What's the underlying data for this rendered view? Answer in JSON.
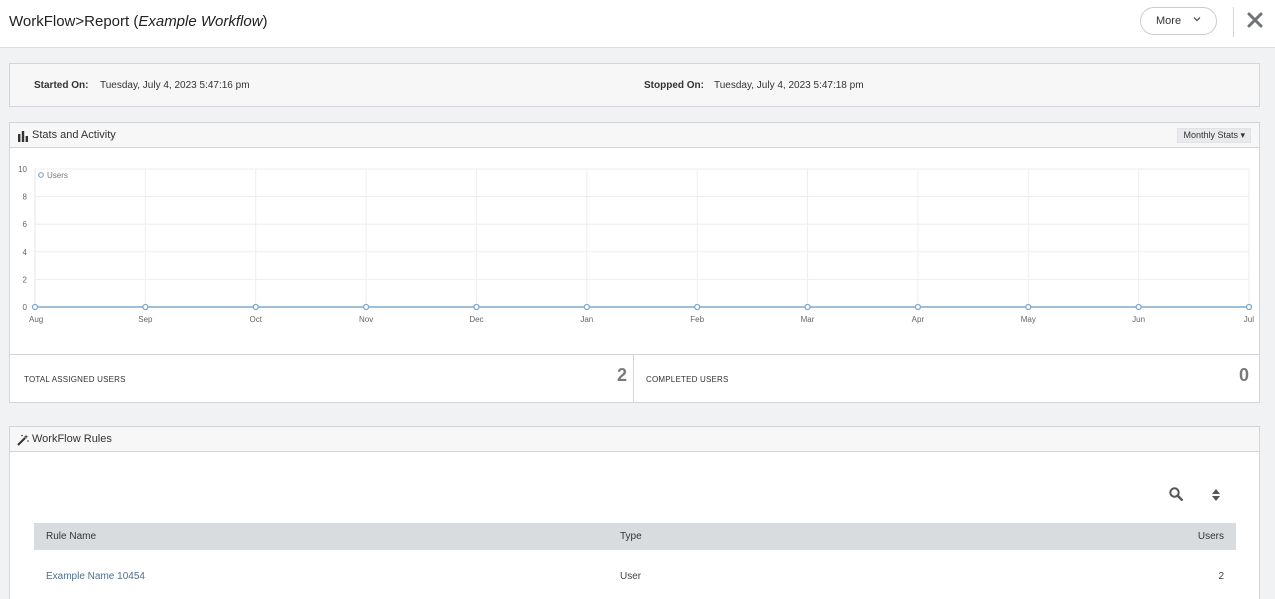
{
  "header": {
    "title_prefix": "WorkFlow>Report (",
    "title_workflow": "Example Workflow",
    "title_suffix": ")",
    "more_label": "More",
    "close_icon": "close-icon"
  },
  "run_info": {
    "started_label": "Started On:",
    "started_value": "Tuesday, July 4, 2023 5:47:16 pm",
    "stopped_label": "Stopped On:",
    "stopped_value": "Tuesday, July 4, 2023 5:47:18 pm"
  },
  "stats_panel": {
    "title": "Stats and Activity",
    "icon": "bar-chart-icon",
    "range_select": "Monthly Stats ▾"
  },
  "chart_data": {
    "type": "line",
    "categories": [
      "Aug",
      "Sep",
      "Oct",
      "Nov",
      "Dec",
      "Jan",
      "Feb",
      "Mar",
      "Apr",
      "May",
      "Jun",
      "Jul"
    ],
    "series": [
      {
        "name": "Users",
        "values": [
          0,
          0,
          0,
          0,
          0,
          0,
          0,
          0,
          0,
          0,
          0,
          0
        ],
        "color": "#7ea9cf"
      }
    ],
    "yticks": [
      0,
      2,
      4,
      6,
      8,
      10
    ],
    "ylim": [
      0,
      10
    ],
    "grid": true,
    "legend": "top-left"
  },
  "kpis": [
    {
      "label": "TOTAL ASSIGNED USERS",
      "value": "2"
    },
    {
      "label": "COMPLETED USERS",
      "value": "0"
    }
  ],
  "rules_panel": {
    "title": "WorkFlow Rules",
    "icon": "magic-wand-icon",
    "tools": [
      "search-icon",
      "sort-icon"
    ],
    "columns": [
      "Rule Name",
      "Type",
      "Users"
    ],
    "rows": [
      {
        "rule_name": "Example Name 10454",
        "type": "User",
        "users": "2"
      }
    ]
  }
}
